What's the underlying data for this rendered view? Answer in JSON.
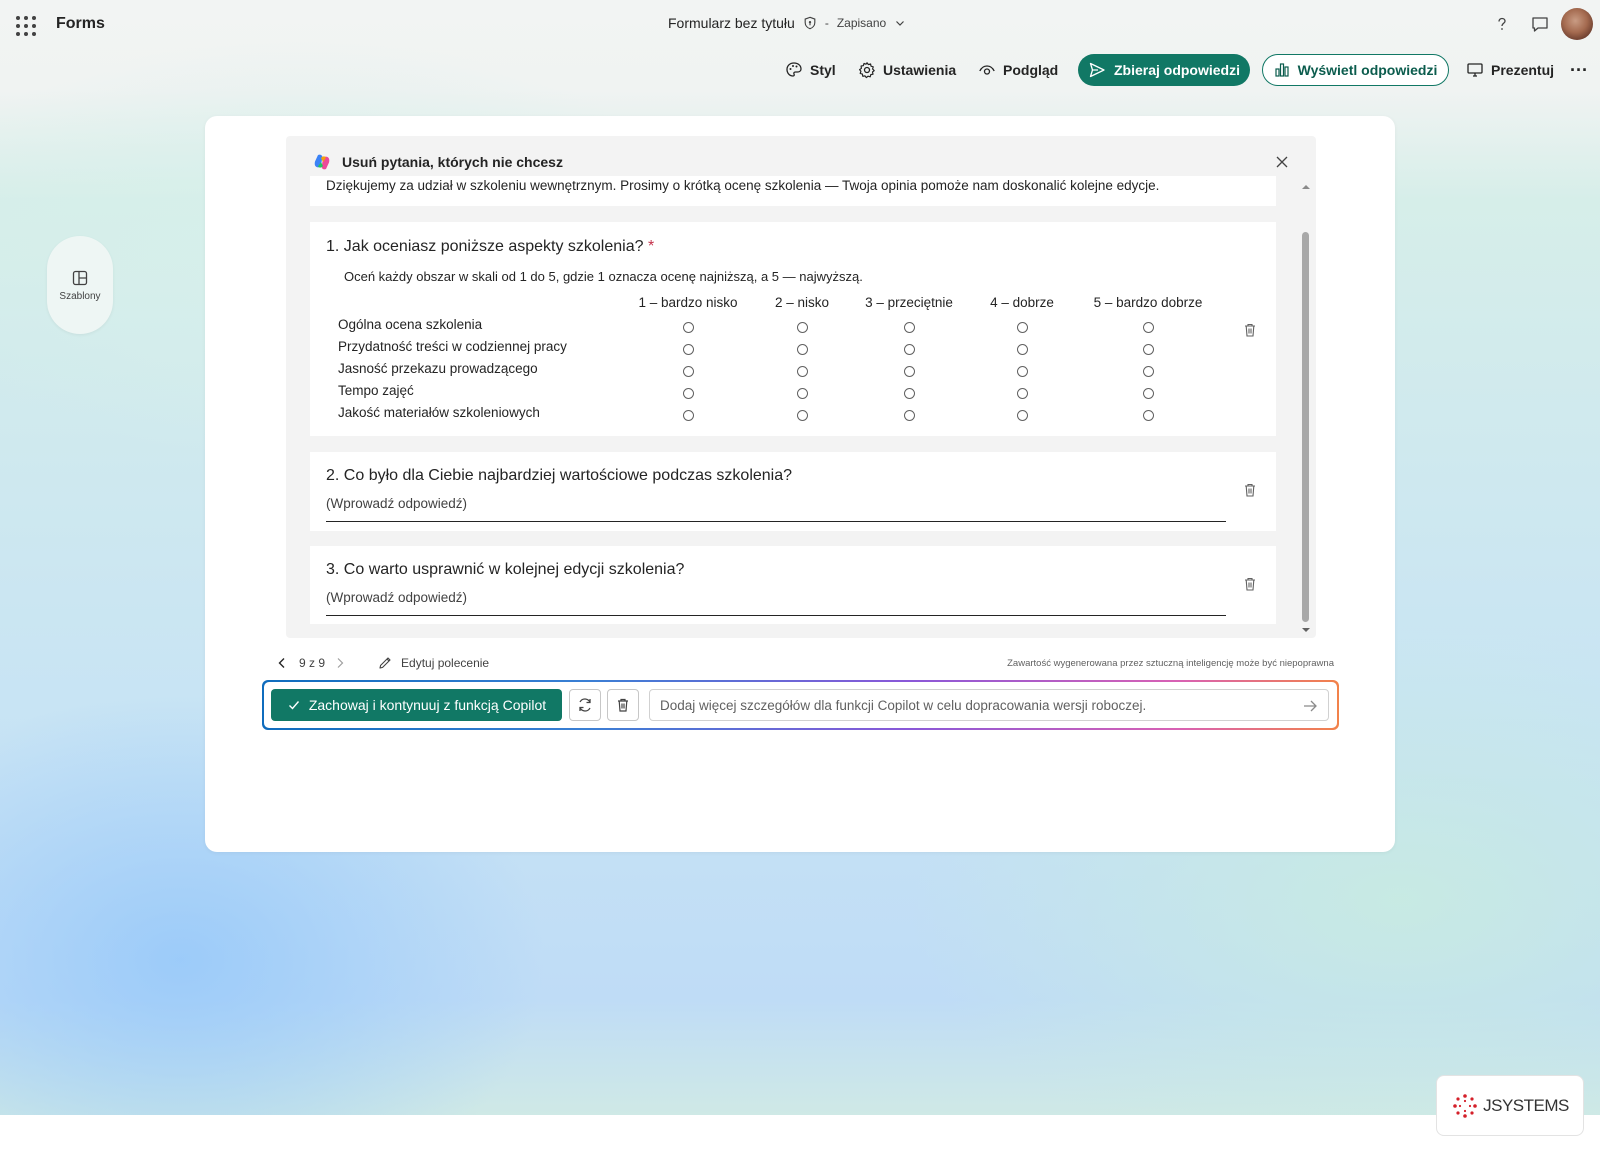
{
  "app": {
    "name": "Forms"
  },
  "header": {
    "form_title": "Formularz bez tytułu",
    "separator": "-",
    "save_status": "Zapisano"
  },
  "toolbar": {
    "style": "Styl",
    "settings": "Ustawienia",
    "preview": "Podgląd",
    "collect": "Zbieraj odpowiedzi",
    "view_responses": "Wyświetl odpowiedzi",
    "present": "Prezentuj"
  },
  "side": {
    "templates": "Szablony"
  },
  "copilot": {
    "panel_title": "Usuń pytania, których nie chcesz",
    "description": "Dziękujemy za udział w szkoleniu wewnętrznym. Prosimy o krótką ocenę szkolenia — Twoja opinia pomoże nam doskonalić kolejne edycje.",
    "pagination": "9 z 9",
    "edit_prompt": "Edytuj polecenie",
    "ai_note": "Zawartość wygenerowana przez sztuczną inteligencję może być niepoprawna",
    "keep_button": "Zachowaj i kontynuuj z funkcją Copilot",
    "input_placeholder": "Dodaj więcej szczegółów dla funkcji Copilot w celu dopracowania wersji roboczej."
  },
  "questions": {
    "q1": {
      "title": "1. Jak oceniasz poniższe aspekty szkolenia?",
      "required_mark": "*",
      "subtitle": "Oceń każdy obszar w skali od 1 do 5, gdzie 1 oznacza ocenę najniższą, a 5 — najwyższą.",
      "columns": [
        "1 – bardzo nisko",
        "2 – nisko",
        "3 – przeciętnie",
        "4 – dobrze",
        "5 – bardzo dobrze"
      ],
      "rows": [
        "Ogólna ocena szkolenia",
        "Przydatność treści w codziennej pracy",
        "Jasność przekazu prowadzącego",
        "Tempo zajęć",
        "Jakość materiałów szkoleniowych"
      ]
    },
    "q2": {
      "title": "2. Co było dla Ciebie najbardziej wartościowe podczas szkolenia?",
      "answer_placeholder": "(Wprowadź odpowiedź)"
    },
    "q3": {
      "title": "3. Co warto usprawnić w kolejnej edycji szkolenia?",
      "answer_placeholder": "(Wprowadź odpowiedź)"
    }
  },
  "branding": {
    "logo_text": "JSYSTEMS"
  },
  "colors": {
    "accent": "#117865",
    "background_top": "#f2f4f3"
  }
}
